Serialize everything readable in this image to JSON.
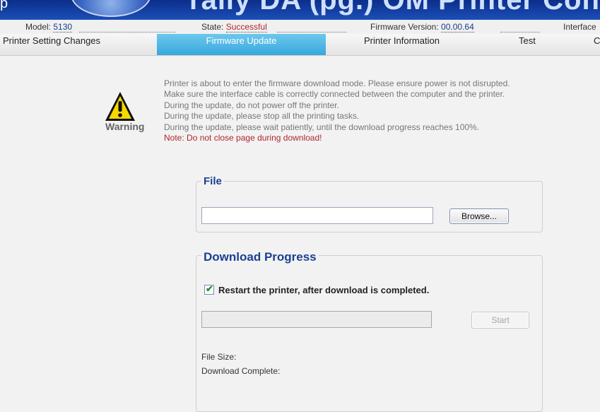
{
  "header": {
    "title_fragment": "raily DA (pg.) OM Printer Config",
    "left_fragment": "p"
  },
  "status_bar": {
    "model_label": "Model:",
    "model_value": "5130",
    "state_label": "State:",
    "state_value": "Successful",
    "firmware_label": "Firmware Version:",
    "firmware_value": "00.00.64",
    "interface_label": "Interface"
  },
  "tabs": [
    {
      "label": "Printer Setting Changes"
    },
    {
      "label": "Firmware Update",
      "active": true
    },
    {
      "label": "Printer Information"
    },
    {
      "label": "Test"
    },
    {
      "label": "C"
    }
  ],
  "warning": {
    "icon": "warning-triangle-icon",
    "label": "Warning",
    "messages": [
      "Printer is about to enter the firmware download mode. Please ensure power is not disrupted.",
      "Make sure the interface cable is correctly connected between the computer and the printer.",
      "During the update, do not power off the printer.",
      "During the update, please stop all the printing tasks.",
      "During the update, please wait patiently, until the download progress reaches 100%."
    ],
    "note": "Note: Do not close page during download!"
  },
  "file_section": {
    "legend": "File",
    "file_path_value": "",
    "browse_label": "Browse..."
  },
  "download_section": {
    "legend": "Download Progress",
    "restart_checkbox_label": "Restart the printer, after download is completed.",
    "restart_checked": true,
    "progress_value": 0,
    "start_label": "Start",
    "file_size_label": "File Size:",
    "download_complete_label": "Download Complete:"
  },
  "colors": {
    "accent_tab": "#38a8de",
    "legend_blue": "#1c3f94",
    "note_red": "#b0262d"
  }
}
